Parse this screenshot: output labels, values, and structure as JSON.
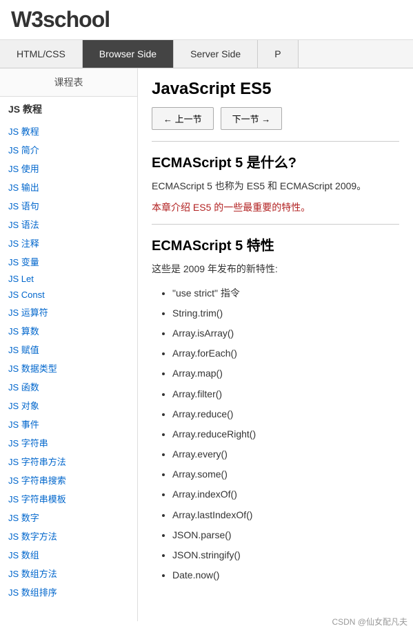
{
  "header": {
    "logo_w3": "W3",
    "logo_school": "school"
  },
  "nav": {
    "tabs": [
      {
        "id": "html-css",
        "label": "HTML/CSS",
        "active": false
      },
      {
        "id": "browser-side",
        "label": "Browser Side",
        "active": true
      },
      {
        "id": "server-side",
        "label": "Server Side",
        "active": false
      },
      {
        "id": "more",
        "label": "P",
        "active": false
      }
    ]
  },
  "sidebar": {
    "title": "课程表",
    "section_title": "JS 教程",
    "links": [
      "JS 教程",
      "JS 简介",
      "JS 使用",
      "JS 输出",
      "JS 语句",
      "JS 语法",
      "JS 注释",
      "JS 变量",
      "JS Let",
      "JS Const",
      "JS 运算符",
      "JS 算数",
      "JS 赋值",
      "JS 数据类型",
      "JS 函数",
      "JS 对象",
      "JS 事件",
      "JS 字符串",
      "JS 字符串方法",
      "JS 字符串搜索",
      "JS 字符串模板",
      "JS 数字",
      "JS 数字方法",
      "JS 数组",
      "JS 数组方法",
      "JS 数组排序"
    ]
  },
  "main": {
    "page_title": "JavaScript ES5",
    "prev_btn": "← 上一节",
    "next_btn": "下一节 →",
    "section1_title": "ECMAScript 5 是什么?",
    "section1_text1": "ECMAScript 5 也称为 ES5 和 ECMAScript 2009。",
    "section1_text2": "本章介绍 ES5 的一些最重要的特性。",
    "section2_title": "ECMAScript 5 特性",
    "section2_intro": "这些是 2009 年发布的新特性:",
    "features": [
      "\"use strict\" 指令",
      "String.trim()",
      "Array.isArray()",
      "Array.forEach()",
      "Array.map()",
      "Array.filter()",
      "Array.reduce()",
      "Array.reduceRight()",
      "Array.every()",
      "Array.some()",
      "Array.indexOf()",
      "Array.lastIndexOf()",
      "JSON.parse()",
      "JSON.stringify()",
      "Date.now()"
    ],
    "watermark": "CSDN @仙女配凡夫"
  }
}
